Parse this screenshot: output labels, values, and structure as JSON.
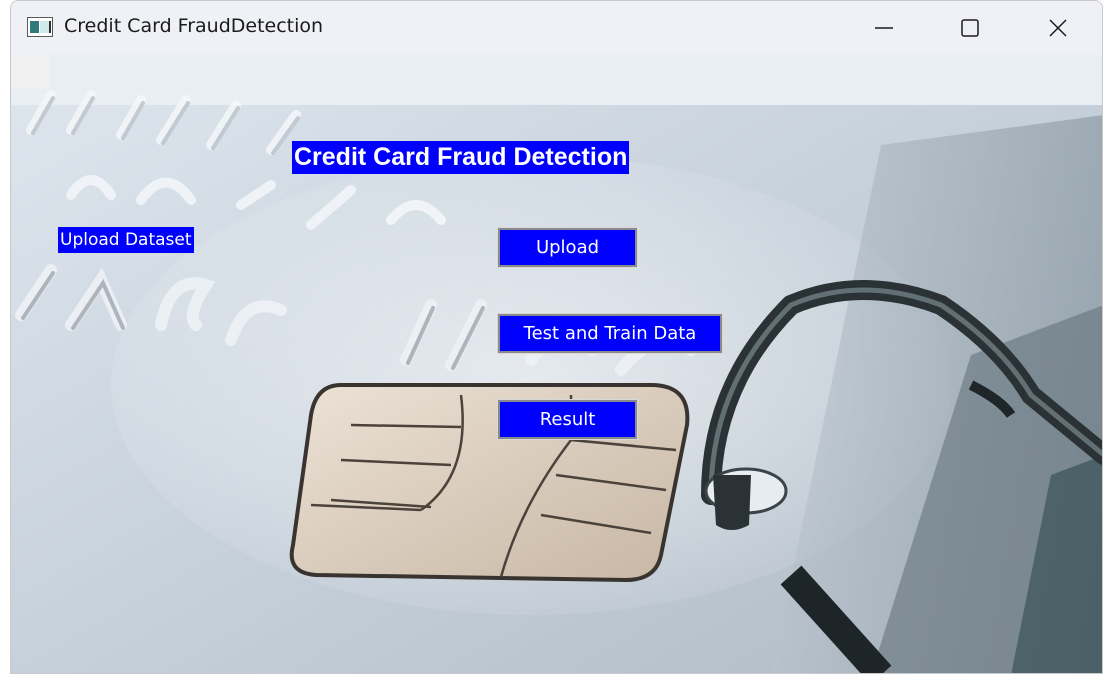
{
  "window": {
    "title": "Credit Card FraudDetection",
    "icon": "app-window-icon",
    "controls": [
      "minimize-icon",
      "maximize-icon",
      "close-icon"
    ]
  },
  "main": {
    "heading": "Credit Card Fraud Detection",
    "upload_label": "Upload Dataset",
    "buttons": {
      "upload": "Upload",
      "train": "Test and Train Data",
      "result": "Result"
    }
  },
  "colors": {
    "accent": "#0000ff",
    "text_on_accent": "#ffffff",
    "titlebar": "#eff1f6"
  }
}
